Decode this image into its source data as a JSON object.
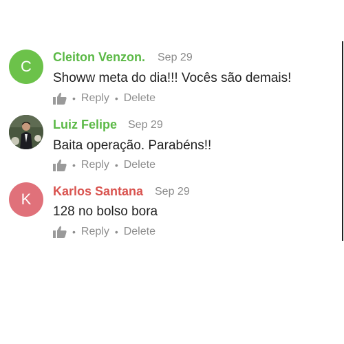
{
  "comments": [
    {
      "author": "Cleiton Venzon.",
      "date": "Sep 29",
      "text": "Showw meta do dia!!! Vocês são demais!",
      "avatar_initial": "C",
      "avatar_color": "#6cc24a",
      "name_color": "#5bb946",
      "reply_label": "Reply",
      "delete_label": "Delete"
    },
    {
      "author": "Luiz Felipe",
      "date": "Sep 29",
      "text": "Baita operação. Parabéns!!",
      "avatar_initial": "",
      "avatar_color": "#3a4a3c",
      "name_color": "#5bb946",
      "reply_label": "Reply",
      "delete_label": "Delete"
    },
    {
      "author": "Karlos Santana",
      "date": "Sep 29",
      "text": "128 no bolso bora",
      "avatar_initial": "K",
      "avatar_color": "#e0717a",
      "name_color": "#d9534f",
      "reply_label": "Reply",
      "delete_label": "Delete"
    }
  ],
  "separator": "•",
  "icons": {
    "like": "thumbs-up-icon"
  }
}
